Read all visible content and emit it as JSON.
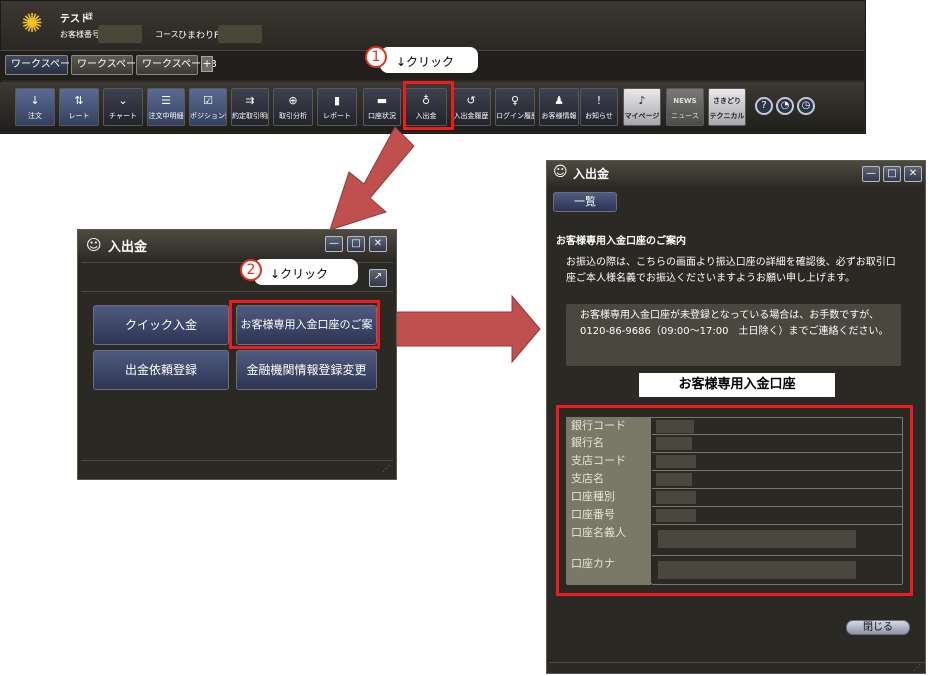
{
  "top_window": {
    "user_name": "テスト",
    "user_suffix": "様",
    "customer_number_label": "お客様番号",
    "course_label": "コース",
    "course_name": "ひまわりFX",
    "tabs": [
      "ワークスペー...",
      "ワークスペース2",
      "ワークスペース3"
    ],
    "add_tab": "+",
    "toolbar": [
      {
        "label": "注文",
        "icon": "↓",
        "style": "blue-dark"
      },
      {
        "label": "レート",
        "icon": "⇅",
        "style": "blue"
      },
      {
        "label": "チャート",
        "icon": "⌄",
        "style": "dark"
      },
      {
        "label": "注文中明細",
        "icon": "☰",
        "style": "blue"
      },
      {
        "label": "ポジション照会",
        "icon": "☑",
        "style": "blue"
      },
      {
        "label": "約定取引明細",
        "icon": "⇉",
        "style": "dark"
      },
      {
        "label": "取引分析",
        "icon": "⊕",
        "style": "dark"
      },
      {
        "label": "レポート",
        "icon": "▮",
        "style": "dark"
      },
      {
        "label": "口座状況",
        "icon": "▬",
        "style": "dark"
      },
      {
        "label": "入出金",
        "icon": "♁",
        "style": "dark"
      },
      {
        "label": "入出金履歴",
        "icon": "↺",
        "style": "dark"
      },
      {
        "label": "ログイン履歴",
        "icon": "♀",
        "style": "dark"
      },
      {
        "label": "お客様情報",
        "icon": "♟",
        "style": "dark"
      },
      {
        "label": "お知らせ",
        "icon": "!",
        "style": "dark"
      },
      {
        "label": "マイページ",
        "icon": "♪",
        "style": "light"
      },
      {
        "label": "ニュース",
        "icon": "NEWS",
        "style": "gray"
      },
      {
        "label": "テクニカル",
        "icon": "さきどり",
        "style": "light"
      }
    ],
    "help_buttons": [
      "?",
      "◔",
      "◷"
    ]
  },
  "callouts": {
    "step1_number": "1",
    "step1_text": "↓クリック",
    "step2_number": "2",
    "step2_text": "↓クリック"
  },
  "deposit_window": {
    "title": "入出金",
    "buttons": {
      "quick_deposit": "クイック入金",
      "dedicated_account": "お客様専用入金口座のご案内",
      "withdraw_request": "出金依頼登録",
      "bank_register": "金融機関情報登録変更"
    }
  },
  "account_window": {
    "title": "入出金",
    "list_button": "一覧",
    "heading": "お客様専用入金口座のご案内",
    "notice": "お振込の際は、こちらの画面より振込口座の詳細を確認後、必ずお取引口座ご本人様名義でお振込くださいますようお願い申し上げます。",
    "info_box": "お客様専用入金口座が未登録となっている場合は、お手数ですが、0120-86-9686（09:00～17:00　土日除く）までご連絡ください。",
    "section_title": "お客様専用入金口座",
    "fields": [
      "銀行コード",
      "銀行名",
      "支店コード",
      "支店名",
      "口座種別",
      "口座番号",
      "口座名義人",
      "口座カナ"
    ],
    "close_button": "閉じる"
  },
  "colors": {
    "highlight_red": "#ee1c1c",
    "arrow_red": "#c0504d",
    "window_bg": "#2b2923"
  }
}
